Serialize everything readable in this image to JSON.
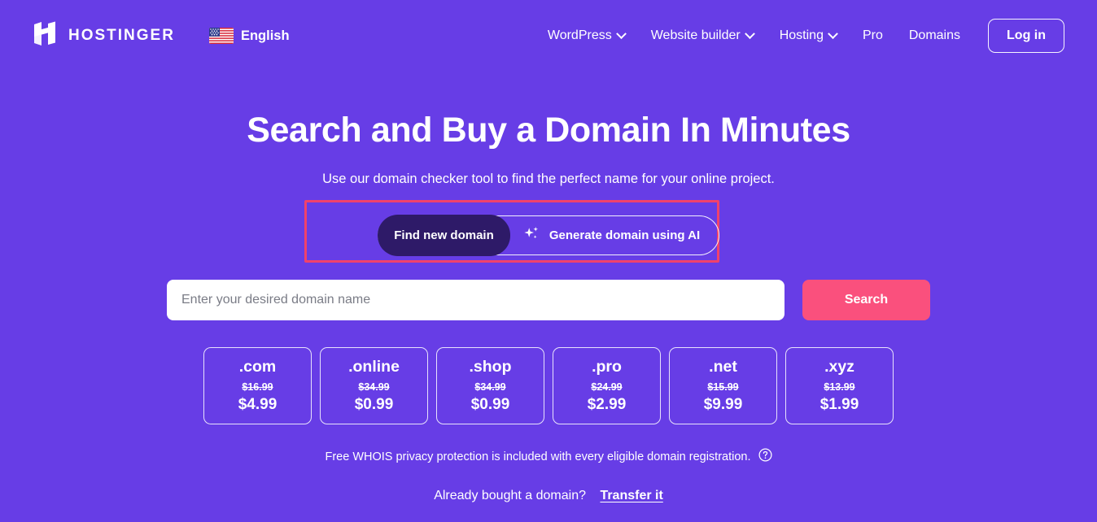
{
  "theme": {
    "background": "#673DE6",
    "accent_pink": "#FA507D",
    "highlight_red": "#F0426B",
    "toggle_active_bg": "#2E1A68",
    "text": "#FFFFFF"
  },
  "header": {
    "brand_name": "HOSTINGER",
    "logo_icon": "hostinger-h-logo",
    "language": {
      "flag_icon": "us-flag-icon",
      "label": "English"
    },
    "nav": [
      {
        "label": "WordPress",
        "has_dropdown": true
      },
      {
        "label": "Website builder",
        "has_dropdown": true
      },
      {
        "label": "Hosting",
        "has_dropdown": true
      },
      {
        "label": "Pro",
        "has_dropdown": false
      },
      {
        "label": "Domains",
        "has_dropdown": false
      }
    ],
    "login_label": "Log in"
  },
  "hero": {
    "title": "Search and Buy a Domain In Minutes",
    "subtitle": "Use our domain checker tool to find the perfect name for your online project."
  },
  "toggle": {
    "find_label": "Find new domain",
    "ai_label": "Generate domain using AI",
    "ai_icon": "sparkle-icon",
    "active": "Find new domain",
    "highlighted": true
  },
  "search": {
    "placeholder": "Enter your desired domain name",
    "value": "",
    "button_label": "Search"
  },
  "tlds": [
    {
      "name": ".com",
      "old_price": "$16.99",
      "new_price": "$4.99"
    },
    {
      "name": ".online",
      "old_price": "$34.99",
      "new_price": "$0.99"
    },
    {
      "name": ".shop",
      "old_price": "$34.99",
      "new_price": "$0.99"
    },
    {
      "name": ".pro",
      "old_price": "$24.99",
      "new_price": "$2.99"
    },
    {
      "name": ".net",
      "old_price": "$15.99",
      "new_price": "$9.99"
    },
    {
      "name": ".xyz",
      "old_price": "$13.99",
      "new_price": "$1.99"
    }
  ],
  "notes": {
    "whois": "Free WHOIS privacy protection is included with every eligible domain registration.",
    "whois_icon": "help-circle-icon",
    "transfer_question": "Already bought a domain?",
    "transfer_link": "Transfer it"
  }
}
